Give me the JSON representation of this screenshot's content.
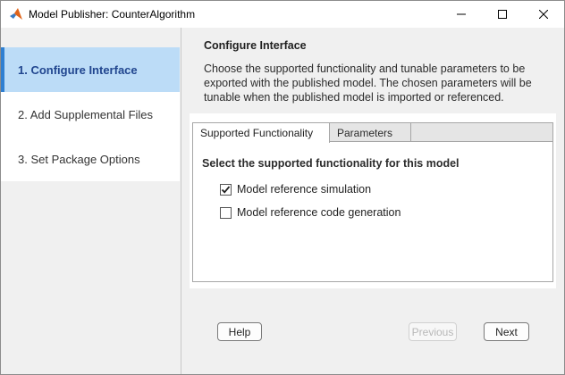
{
  "window": {
    "title": "Model Publisher: CounterAlgorithm",
    "icon": "matlab-icon",
    "controls": [
      "minimize-icon",
      "maximize-icon",
      "close-icon"
    ]
  },
  "sidebar": {
    "items": [
      {
        "label": "1. Configure Interface",
        "active": true
      },
      {
        "label": "2. Add Supplemental Files",
        "active": false
      },
      {
        "label": "3. Set Package Options",
        "active": false
      }
    ]
  },
  "main": {
    "title": "Configure Interface",
    "description": "Choose the supported functionality and tunable parameters to be exported with the published model. The chosen parameters will be tunable when the published model is imported or referenced.",
    "tabs": [
      {
        "label": "Supported Functionality",
        "selected": true
      },
      {
        "label": "Parameters",
        "selected": false
      }
    ],
    "panel_heading": "Select the supported functionality for this model",
    "options": [
      {
        "label": "Model reference simulation",
        "checked": true
      },
      {
        "label": "Model reference code generation",
        "checked": false
      }
    ]
  },
  "buttons": {
    "help": "Help",
    "previous": "Previous",
    "next": "Next"
  },
  "colors": {
    "active_nav_bg": "#bcdcf7",
    "active_nav_text": "#21468f",
    "active_nav_accent": "#2f7fd1"
  }
}
